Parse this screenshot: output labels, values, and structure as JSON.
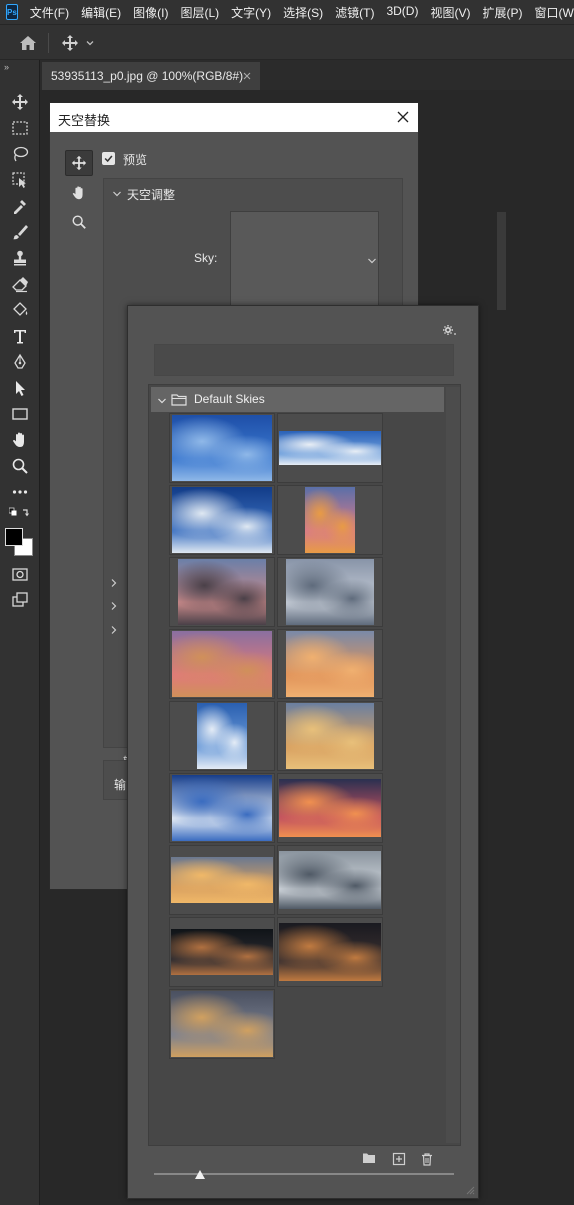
{
  "app": {
    "logo_text": "Ps",
    "menu": [
      "文件(F)",
      "编辑(E)",
      "图像(I)",
      "图层(L)",
      "文字(Y)",
      "选择(S)",
      "滤镜(T)",
      "3D(D)",
      "视图(V)",
      "扩展(P)",
      "窗口(W)"
    ]
  },
  "document": {
    "tab_label": "53935113_p0.jpg @ 100%(RGB/8#)"
  },
  "dialog": {
    "title": "天空替换",
    "preview_label": "预览",
    "preview_checked": true,
    "section_label": "天空调整",
    "sky_label": "Sky:",
    "output_label": "输",
    "output_stub": "输"
  },
  "picker": {
    "group_name": "Default Skies",
    "thumbnails": [
      {
        "name": "clear-blue-sky",
        "colors": [
          "#1e4fa8",
          "#3b78cf",
          "#8fb8e8"
        ]
      },
      {
        "name": "blue-sky-small-clouds",
        "colors": [
          "#2b62b8",
          "#6e9fdc",
          "#e8eef5"
        ]
      },
      {
        "name": "blue-sky-scattered-clouds",
        "colors": [
          "#123c88",
          "#3a6fc0",
          "#dfe8f2"
        ]
      },
      {
        "name": "orange-pink-sunset-portrait",
        "colors": [
          "#5a6fa8",
          "#d77a8a",
          "#e89b45"
        ]
      },
      {
        "name": "dusk-pink-streaks",
        "colors": [
          "#6b7fa8",
          "#c98a8a",
          "#4a4048"
        ]
      },
      {
        "name": "grey-cloud-texture",
        "colors": [
          "#8894a8",
          "#c7ced8",
          "#5f6b7c"
        ]
      },
      {
        "name": "pink-red-streaky-sunset",
        "colors": [
          "#8a6fa0",
          "#e07a7a",
          "#d0905a"
        ]
      },
      {
        "name": "orange-cloud-sunset",
        "colors": [
          "#7a8aa8",
          "#e0935a",
          "#f0b070"
        ]
      },
      {
        "name": "blue-popcorn-clouds-portrait",
        "colors": [
          "#2a5fb0",
          "#6a9ad8",
          "#e4ecf6"
        ]
      },
      {
        "name": "golden-clouds-blue-sky",
        "colors": [
          "#6a7fa0",
          "#d8a060",
          "#e8c07a"
        ]
      },
      {
        "name": "white-cumulus-blue-sky",
        "colors": [
          "#163d8a",
          "#e8eef5",
          "#3a6cc0"
        ]
      },
      {
        "name": "dramatic-red-sunset",
        "colors": [
          "#2a3050",
          "#c05060",
          "#f09050"
        ]
      },
      {
        "name": "golden-horizon-birds",
        "colors": [
          "#6a7890",
          "#d8a060",
          "#f0b868"
        ]
      },
      {
        "name": "grey-storm-clouds",
        "colors": [
          "#8a949e",
          "#d0d6dc",
          "#505a66"
        ]
      },
      {
        "name": "dark-sunset-horizon",
        "colors": [
          "#101418",
          "#2a2a30",
          "#b07040"
        ]
      },
      {
        "name": "dark-orange-dusk",
        "colors": [
          "#1a1a20",
          "#3a3030",
          "#c07a40"
        ]
      },
      {
        "name": "cloudy-golden-dusk",
        "colors": [
          "#4a5060",
          "#7a8090",
          "#d0a060"
        ]
      }
    ]
  }
}
